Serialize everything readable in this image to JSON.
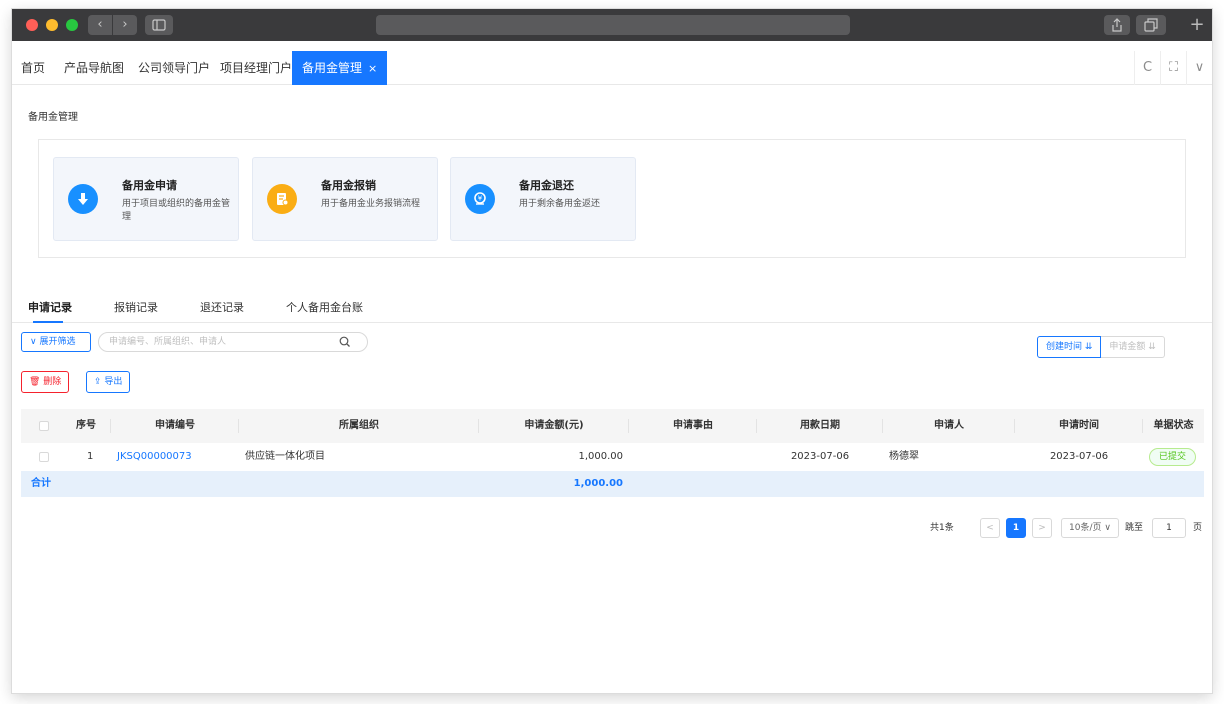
{
  "app_tabs": [
    {
      "label": "首页"
    },
    {
      "label": "产品导航图"
    },
    {
      "label": "公司领导门户"
    },
    {
      "label": "项目经理门户"
    },
    {
      "label": "备用金管理",
      "close": "×"
    }
  ],
  "tab_tools": {
    "refresh": "C",
    "fullscreen": "⛶",
    "more": "∨"
  },
  "page_title": "备用金管理",
  "cards": [
    {
      "title": "备用金申请",
      "desc_line1": "用于项目或组织的备用金管",
      "desc_line2": "理",
      "icon": "download-icon",
      "color": "#1890ff"
    },
    {
      "title": "备用金报销",
      "desc_line1": "用于备用金业务报销流程",
      "desc_line2": "",
      "icon": "document-icon",
      "color": "#faad14"
    },
    {
      "title": "备用金退还",
      "desc_line1": "用于剩余备用金返还",
      "desc_line2": "",
      "icon": "money-icon",
      "color": "#1890ff"
    }
  ],
  "sub_tabs": [
    {
      "label": "申请记录"
    },
    {
      "label": "报销记录"
    },
    {
      "label": "退还记录"
    },
    {
      "label": "个人备用金台账"
    }
  ],
  "filter": {
    "expand_label": "∨  展开筛选",
    "search_placeholder": "申请编号、所属组织、申请人"
  },
  "sort": {
    "created_label": "创建时间 ⇊",
    "amount_label": "申请金额 ⇊"
  },
  "actions": {
    "delete_label": "🗑 删除",
    "export_label": "⇪ 导出"
  },
  "table": {
    "columns": [
      "序号",
      "申请编号",
      "所属组织",
      "申请金额(元)",
      "申请事由",
      "用款日期",
      "申请人",
      "申请时间",
      "单据状态"
    ],
    "rows": [
      {
        "index": "1",
        "code": "JKSQ00000073",
        "org": "供应链一体化项目",
        "amount": "1,000.00",
        "reason": "",
        "use_date": "2023-07-06",
        "applicant": "杨德翠",
        "apply_time": "2023-07-06",
        "status": "已提交"
      }
    ],
    "total_label": "合计",
    "total_amount": "1,000.00"
  },
  "pagination": {
    "total_text": "共1条",
    "prev": "<",
    "current": "1",
    "next": ">",
    "page_size": "10条/页 ∨",
    "jump_label": "跳至",
    "jump_value": "1",
    "page_unit": "页"
  }
}
